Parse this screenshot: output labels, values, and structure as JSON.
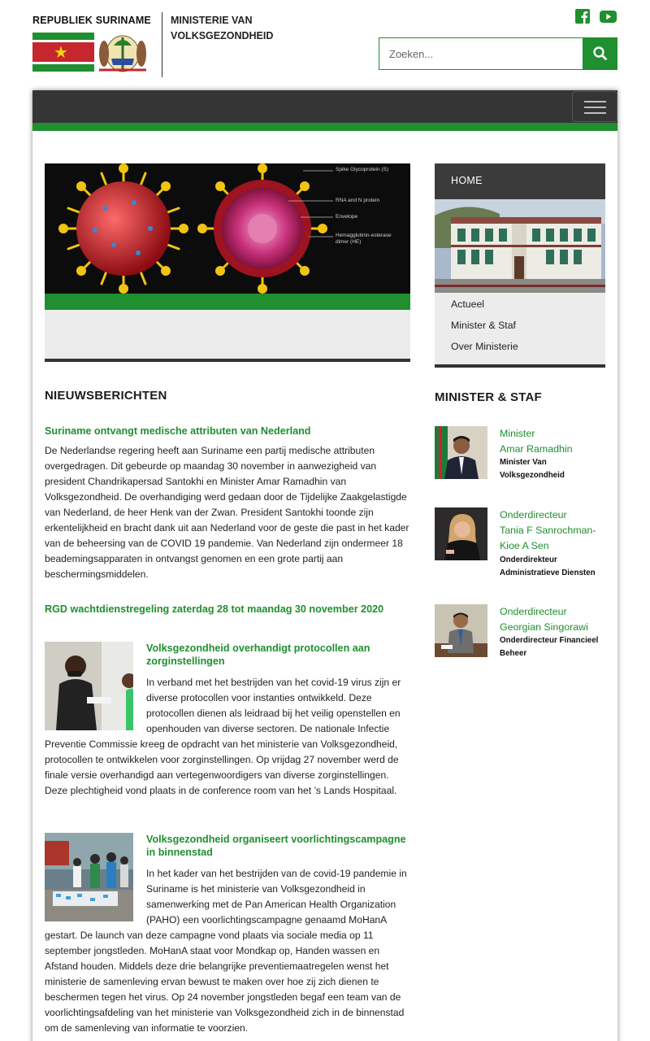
{
  "header": {
    "logo_text": "REPUBLIEK SURINAME",
    "ministry_line1": "MINISTERIE VAN",
    "ministry_line2": "VOLKSGEZONDHEID",
    "social": [
      "facebook-icon",
      "youtube-icon"
    ],
    "search": {
      "placeholder": "Zoeken...",
      "value": ""
    }
  },
  "colors": {
    "brand_green": "#1f8f2f",
    "nav_dark": "#353535",
    "flag_red": "#c6262e",
    "flag_yellow": "#f4d20f"
  },
  "slider": {
    "labels": [
      "Spike Glycoprotein (S)",
      "RNA and N protein",
      "Envelope",
      "Hemagglutinin-esterase",
      "dimer (HE)"
    ]
  },
  "news": {
    "heading": "NIEUWSBERICHTEN",
    "items": [
      {
        "title": "Suriname ontvangt medische attributen van Nederland",
        "body": "De Nederlandse regering heeft aan Suriname een partij medische attributen overgedragen. Dit gebeurde op maandag 30 november in aanwezigheid van president Chandrikapersad Santokhi en Minister Amar Ramadhin van Volksgezondheid. De overhandiging werd gedaan door de Tijdelijke Zaakgelastigde van Nederland, de heer Henk van der Zwan. President Santokhi toonde zijn erkentelijkheid en bracht dank uit aan Nederland voor de geste die past in het kader van de beheersing van de COVID 19 pandemie. Van Nederland zijn ondermeer 18 beademingsapparaten in ontvangst genomen en een grote partij aan beschermingsmiddelen."
      },
      {
        "title": "RGD wachtdienstregeling zaterdag 28 tot maandag 30 november 2020",
        "body": ""
      },
      {
        "title": "Volksgezondheid overhandigt protocollen aan zorginstellingen",
        "body": "In verband met het bestrijden van het covid-19 virus zijn er diverse protocollen voor instanties ontwikkeld. Deze protocollen dienen als leidraad bij het veilig openstellen en openhouden van diverse sectoren. De nationale Infectie Preventie Commissie kreeg de opdracht van het ministerie van Volksgezondheid, protocollen te ontwikkelen voor zorginstellingen. Op vrijdag 27 november werd de finale versie overhandigd aan vertegenwoordigers van diverse zorginstellingen. Deze plechtigheid vond plaats in de conference room van het ’s Lands Hospitaal."
      },
      {
        "title": "Volksgezondheid organiseert voorlichtingscampagne in binnenstad",
        "body": "In het kader van het bestrijden van de covid-19 pandemie in Suriname is het ministerie van Volksgezondheid in samenwerking met de Pan American Health Organization (PAHO) een voorlichtingscampagne genaamd MoHanA gestart. De launch van deze campagne vond plaats via sociale media op 11 september jongstleden. MoHanA staat voor Mondkap op, Handen wassen en Afstand houden. Middels deze drie belangrijke preventiemaatregelen wenst het ministerie de samenleving ervan bewust te maken over hoe zij zich dienen te beschermen tegen het virus. Op 24 november jongstleden begaf een team van de voorlichtingsafdeling van het ministerie van Volksgezondheid zich in de binnenstad om de samenleving van informatie te voorzien."
      }
    ]
  },
  "sidebar": {
    "home_label": "HOME",
    "menu": [
      "Actueel",
      "Minister & Staf",
      "Over Ministerie"
    ],
    "staff_heading": "MINISTER & STAF",
    "staff": [
      {
        "role": "Minister",
        "name": "Amar Ramadhin",
        "function": "Minister Van Volksgezondheid"
      },
      {
        "role": "Onderdirecteur",
        "name": "Tania F Sanrochman-Kioe A Sen",
        "function": "Onderdirekteur Administratieve Diensten"
      },
      {
        "role": "Onderdirecteur",
        "name": "Georgian Singorawi",
        "function": "Onderdirecteur Financieel Beheer"
      }
    ]
  }
}
